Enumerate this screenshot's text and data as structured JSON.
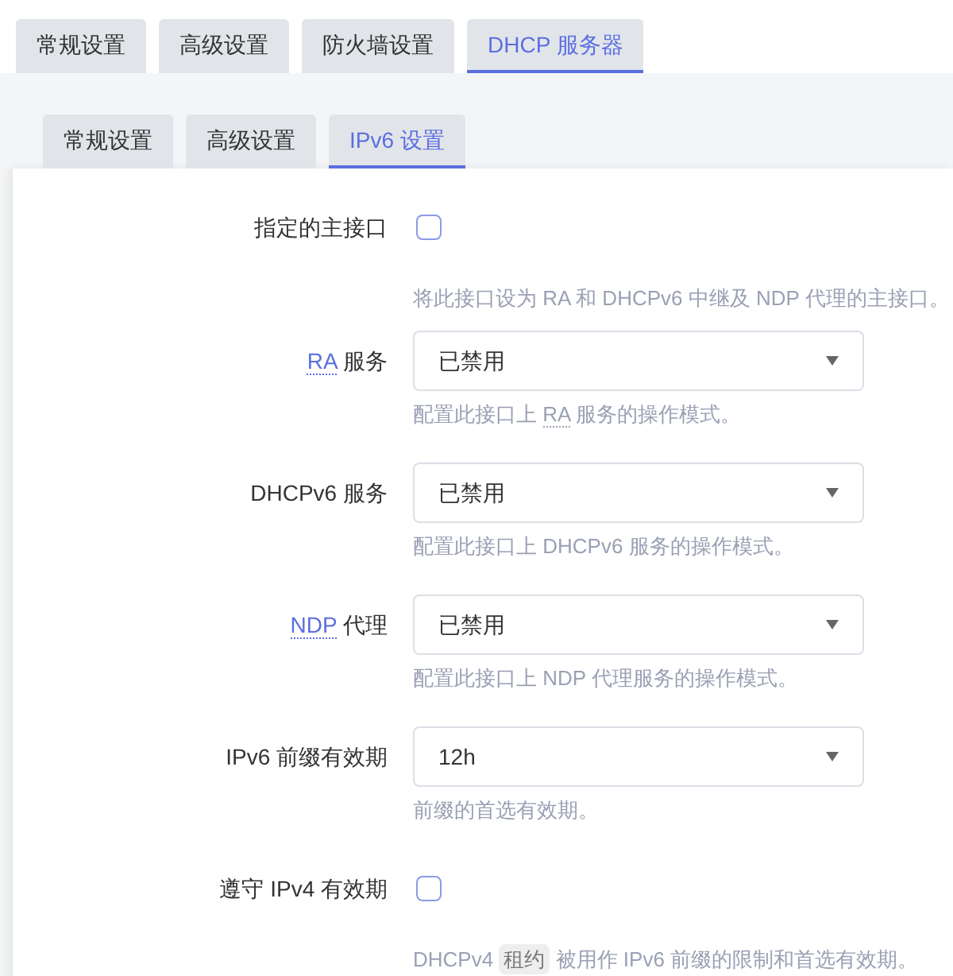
{
  "main_tabs": [
    {
      "label": "常规设置",
      "selected": false
    },
    {
      "label": "高级设置",
      "selected": false
    },
    {
      "label": "防火墙设置",
      "selected": false
    },
    {
      "label": "DHCP 服务器",
      "selected": true
    }
  ],
  "sub_tabs": [
    {
      "label": "常规设置",
      "selected": false
    },
    {
      "label": "高级设置",
      "selected": false
    },
    {
      "label": "IPv6 设置",
      "selected": true
    }
  ],
  "fields": [
    {
      "kind": "checkbox",
      "label": [
        {
          "text": "指定的主接口"
        }
      ],
      "checked": false,
      "description": [
        {
          "text": "将此接口设为 RA 和 DHCPv6 中继及 NDP 代理的主接口。"
        }
      ]
    },
    {
      "kind": "select",
      "label": [
        {
          "text": "RA",
          "kind": "abbr"
        },
        {
          "text": " 服务"
        }
      ],
      "value": "已禁用",
      "description": [
        {
          "text": "配置此接口上 "
        },
        {
          "text": "RA",
          "kind": "abbr"
        },
        {
          "text": " 服务的操作模式。"
        }
      ]
    },
    {
      "kind": "select",
      "label": [
        {
          "text": "DHCPv6 服务"
        }
      ],
      "value": "已禁用",
      "description": [
        {
          "text": "配置此接口上 DHCPv6 服务的操作模式。"
        }
      ]
    },
    {
      "kind": "select",
      "label": [
        {
          "text": "NDP",
          "kind": "abbr"
        },
        {
          "text": " 代理"
        }
      ],
      "value": "已禁用",
      "description": [
        {
          "text": "配置此接口上 NDP 代理服务的操作模式。"
        }
      ]
    },
    {
      "kind": "select",
      "label": [
        {
          "text": "IPv6 前缀有效期"
        }
      ],
      "value": "12h",
      "description": [
        {
          "text": "前缀的首选有效期。"
        }
      ]
    },
    {
      "kind": "checkbox",
      "label": [
        {
          "text": "遵守 IPv4 有效期"
        }
      ],
      "checked": false,
      "description": [
        {
          "text": "DHCPv4 "
        },
        {
          "text": "租约",
          "kind": "code"
        },
        {
          "text": " 被用作 IPv6 前缀的限制和首选有效期。"
        }
      ]
    }
  ]
}
